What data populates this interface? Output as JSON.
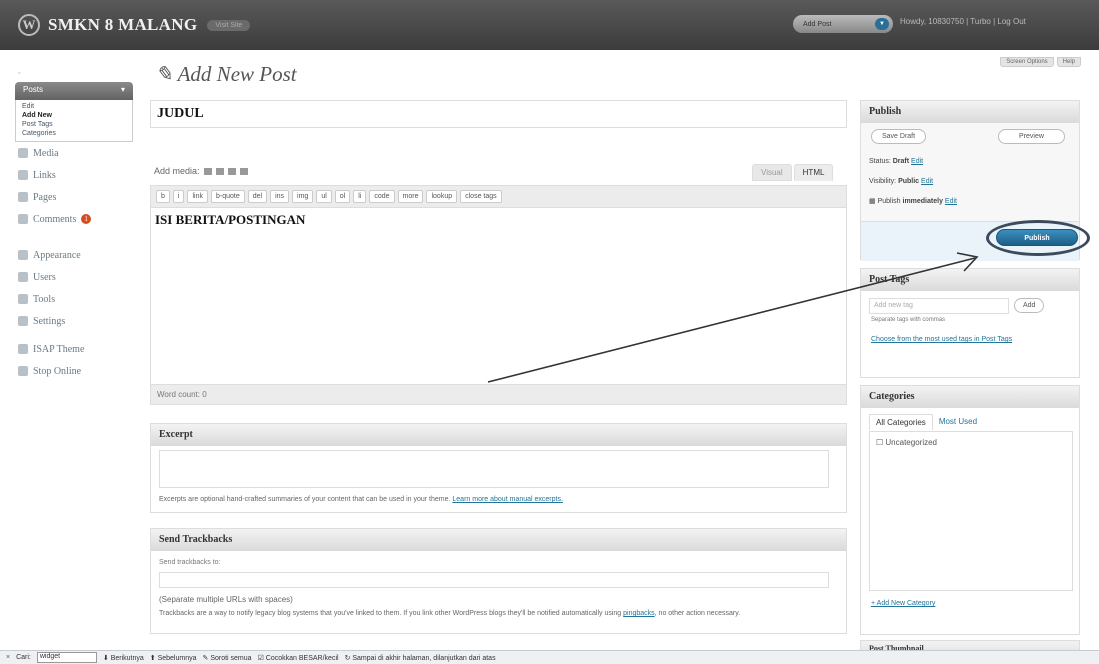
{
  "topbar": {
    "site_title": "SMKN 8 MALANG",
    "visit_site": "Visit Site",
    "favorites": "Add Post",
    "howdy": "Howdy, 10830750 | Turbo | Log Out"
  },
  "screen_options": {
    "screen_options": "Screen Options",
    "help": "Help"
  },
  "sidebar": {
    "posts_label": "Posts",
    "posts_sub": [
      "Edit",
      "Add New",
      "Post Tags",
      "Categories"
    ],
    "items_top": [
      "Media",
      "Links",
      "Pages",
      "Comments"
    ],
    "comments_count": "1",
    "items_mid": [
      "Appearance",
      "Users",
      "Tools",
      "Settings"
    ],
    "items_bottom": [
      "ISAP Theme",
      "Stop Online"
    ]
  },
  "page": {
    "title": "Add New Post"
  },
  "post": {
    "title_value": "JUDUL",
    "body_value": "ISI BERITA/POSTINGAN"
  },
  "editor": {
    "add_media": "Add media:",
    "visual_tab": "Visual",
    "html_tab": "HTML",
    "quicktags": [
      "b",
      "i",
      "link",
      "b-quote",
      "del",
      "ins",
      "img",
      "ul",
      "ol",
      "li",
      "code",
      "more",
      "lookup",
      "close tags"
    ],
    "word_count": "Word count: 0"
  },
  "excerpt": {
    "heading": "Excerpt",
    "help": "Excerpts are optional hand-crafted summaries of your content that can be used in your theme.",
    "help_link": "Learn more about manual excerpts."
  },
  "trackbacks": {
    "heading": "Send Trackbacks",
    "label": "Send trackbacks to:",
    "separate": "(Separate multiple URLs with spaces)",
    "help": "Trackbacks are a way to notify legacy blog systems that you've linked to them. If you link other WordPress blogs they'll be notified automatically using",
    "help_link": "pingbacks",
    "help_end": ", no other action necessary."
  },
  "publish": {
    "heading": "Publish",
    "save_draft": "Save Draft",
    "preview": "Preview",
    "status_label": "Status:",
    "status_value": "Draft",
    "visibility_label": "Visibility:",
    "visibility_value": "Public",
    "publish_when": "Publish",
    "publish_when_value": "immediately",
    "edit": "Edit",
    "publish_button": "Publish"
  },
  "tags": {
    "heading": "Post Tags",
    "placeholder": "Add new tag",
    "add": "Add",
    "separate": "Separate tags with commas",
    "choose": "Choose from the most used tags in Post Tags"
  },
  "categories": {
    "heading": "Categories",
    "tab_all": "All Categories",
    "tab_most": "Most Used",
    "items": [
      "Uncategorized"
    ],
    "add_new": "+ Add New Category"
  },
  "thumbnail": {
    "heading": "Post Thumbnail"
  },
  "findbar": {
    "close": "×",
    "label": "Cari:",
    "value": "widget",
    "next": "Berikutnya",
    "prev": "Sebelumnya",
    "highlight": "Soroti semua",
    "match_case": "Cocokkan BESAR/kecil",
    "wrap": "Sampai di akhir halaman, dilanjutkan dari atas"
  },
  "colors": {
    "topbar": "#464646",
    "accent": "#21759b",
    "publish": "#2a7bab",
    "badge": "#d54e21"
  }
}
